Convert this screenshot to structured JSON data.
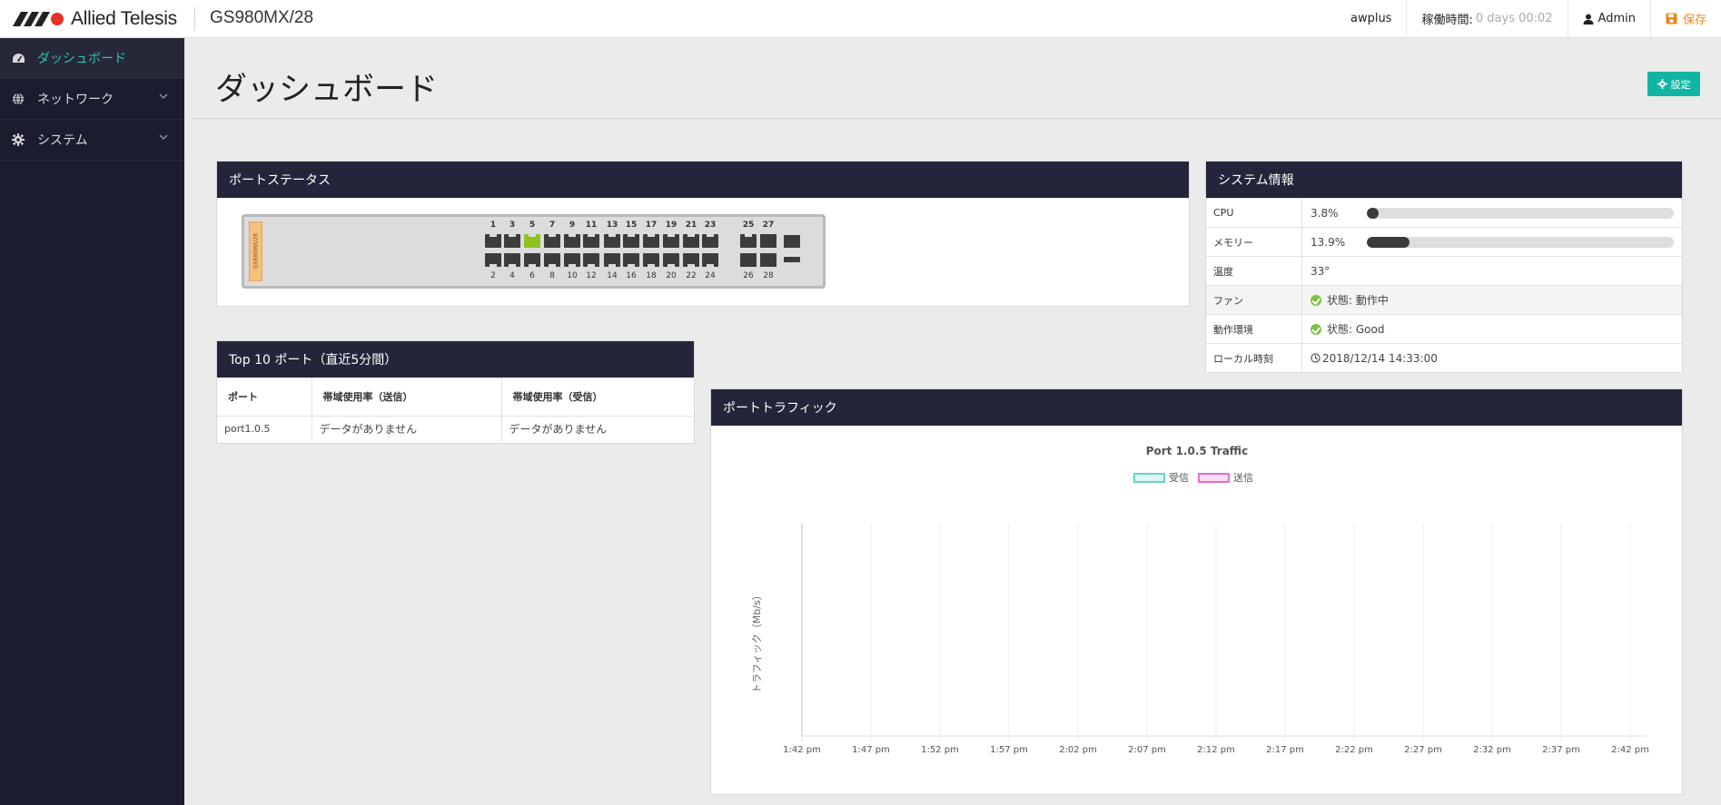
{
  "header": {
    "brand": "Allied Telesis",
    "model": "GS980MX/28",
    "hostname": "awplus",
    "uptime_label": "稼働時間:",
    "uptime_value": "0 days 00:02",
    "user": "Admin",
    "save_label": "保存"
  },
  "sidebar": {
    "items": [
      {
        "label": "ダッシュボード",
        "icon": "dashboard-icon"
      },
      {
        "label": "ネットワーク",
        "icon": "globe-icon"
      },
      {
        "label": "システム",
        "icon": "gear-icon"
      }
    ]
  },
  "page": {
    "title": "ダッシュボード",
    "settings_label": "設定"
  },
  "port_status": {
    "title": "ポートステータス",
    "device_tag": "GS980MX/28",
    "top_numbers": [
      "1",
      "3",
      "5",
      "7",
      "9",
      "11",
      "13",
      "15",
      "17",
      "19",
      "21",
      "23",
      "25",
      "27"
    ],
    "bottom_numbers": [
      "2",
      "4",
      "6",
      "8",
      "10",
      "12",
      "14",
      "16",
      "18",
      "20",
      "22",
      "24",
      "26",
      "28"
    ],
    "link_up_ports": [
      "5"
    ]
  },
  "system_info": {
    "title": "システム情報",
    "rows": [
      {
        "label": "CPU",
        "value": "3.8%",
        "percent": 3.8
      },
      {
        "label": "メモリー",
        "value": "13.9%",
        "percent": 13.9
      },
      {
        "label": "温度",
        "value": "33°"
      },
      {
        "label": "ファン",
        "value": "状態: 動作中",
        "status": "ok"
      },
      {
        "label": "動作環境",
        "value": "状態: Good",
        "status": "ok"
      },
      {
        "label": "ローカル時刻",
        "value": "2018/12/14 14:33:00"
      }
    ]
  },
  "top10": {
    "title": "Top 10 ポート（直近5分間）",
    "columns": [
      "ポート",
      "帯域使用率（送信）",
      "帯域使用率（受信）"
    ],
    "rows": [
      [
        "port1.0.5",
        "データがありません",
        "データがありません"
      ]
    ]
  },
  "traffic": {
    "panel_title": "ポートトラフィック",
    "chart_data": {
      "type": "line",
      "title": "Port 1.0.5 Traffic",
      "ylabel": "トラフィック（Mb/s）",
      "xlabel": "",
      "categories": [
        "1:42 pm",
        "1:47 pm",
        "1:52 pm",
        "1:57 pm",
        "2:02 pm",
        "2:07 pm",
        "2:12 pm",
        "2:17 pm",
        "2:22 pm",
        "2:27 pm",
        "2:32 pm",
        "2:37 pm",
        "2:42 pm"
      ],
      "series": [
        {
          "name": "受信",
          "color": "#65d4c3",
          "values": []
        },
        {
          "name": "送信",
          "color": "#e66fca",
          "values": []
        }
      ],
      "grid": true,
      "legend": "top"
    }
  }
}
